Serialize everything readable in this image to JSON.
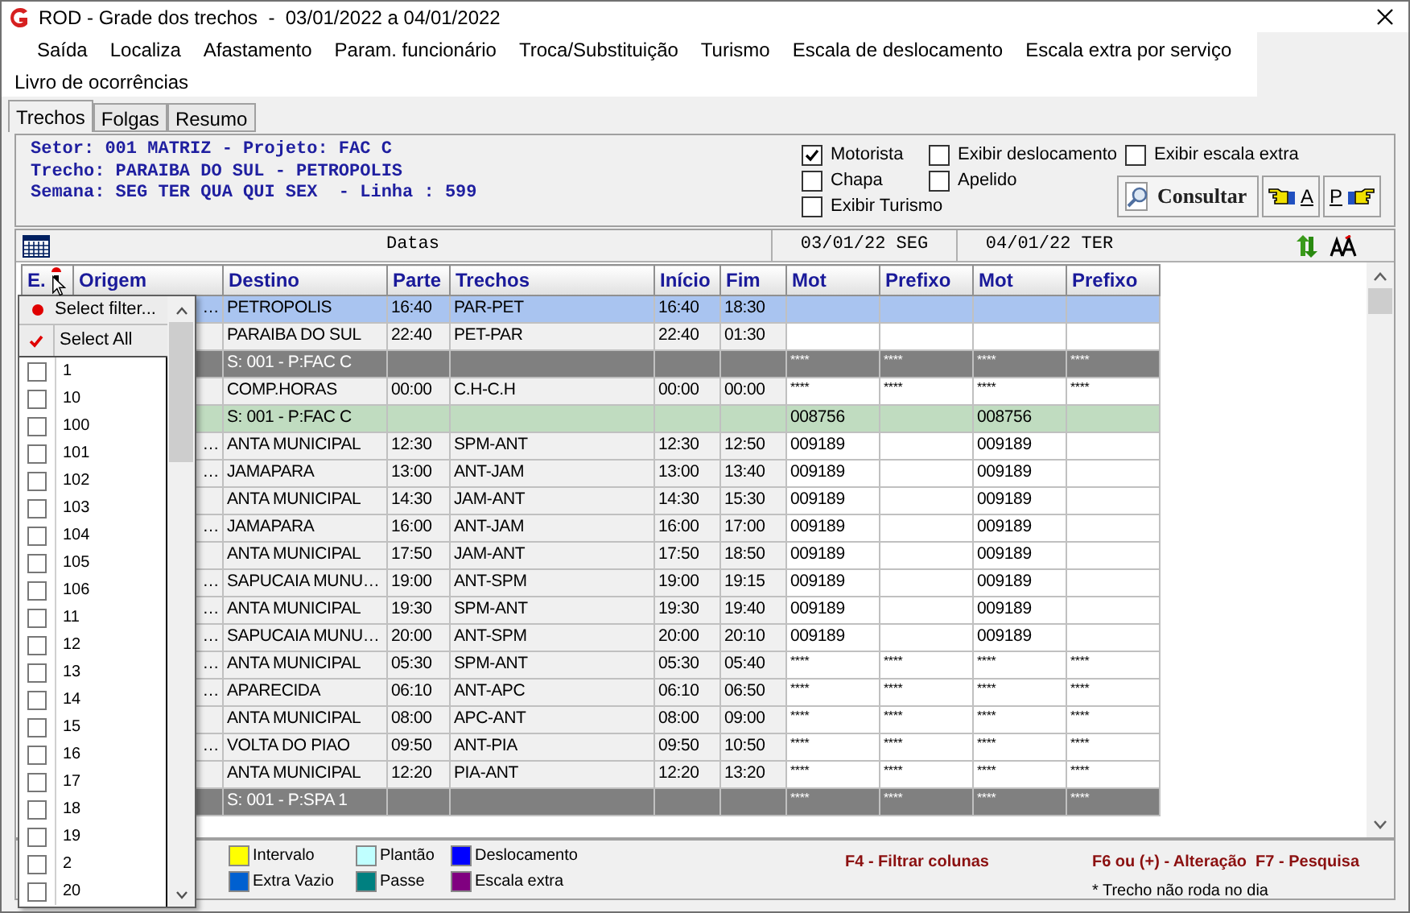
{
  "window": {
    "title": "ROD - Grade dos trechos  -  03/01/2022 a 04/01/2022"
  },
  "menu": [
    "Saída",
    "Localiza",
    "Afastamento",
    "Param. funcionário",
    "Troca/Substituição",
    "Turismo",
    "Escala de deslocamento",
    "Escala extra por serviço",
    "Livro de ocorrências"
  ],
  "tabs": [
    {
      "label": "Trechos",
      "selected": true
    },
    {
      "label": "Folgas",
      "selected": false
    },
    {
      "label": "Resumo",
      "selected": false
    }
  ],
  "info": [
    "Setor: 001 MATRIZ - Projeto: FAC C",
    "Trecho: PARAIBA DO SUL - PETROPOLIS",
    "Semana: SEG TER QUA QUI SEX  - Linha : 599"
  ],
  "options": [
    {
      "label": "Motorista",
      "checked": true
    },
    {
      "label": "Exibir deslocamento",
      "checked": false
    },
    {
      "label": "Exibir escala extra",
      "checked": false
    },
    {
      "label": "Chapa",
      "checked": false
    },
    {
      "label": "Apelido",
      "checked": false
    },
    {
      "label": "Exibir Turismo",
      "checked": false
    }
  ],
  "buttons": {
    "consultar": "Consultar",
    "previous": "A",
    "next": "P"
  },
  "grid_header": {
    "title": "Datas",
    "dates": [
      "03/01/22 SEG",
      "04/01/22 TER"
    ]
  },
  "columns": [
    "E.",
    "Origem",
    "Destino",
    "Parte",
    "Trechos",
    "Início",
    "Fim",
    "Mot",
    "Prefixo",
    "Mot",
    "Prefixo"
  ],
  "rows": [
    {
      "kind": "normal",
      "selected": true,
      "origem": "…",
      "destino": "PETROPOLIS",
      "parte": "16:40",
      "trechos": "PAR-PET",
      "inicio": "16:40",
      "fim": "18:30",
      "cells": [
        null,
        null,
        null,
        null
      ]
    },
    {
      "kind": "normal",
      "selected": false,
      "destino": "PARAIBA DO SUL",
      "parte": "22:40",
      "trechos": "PET-PAR",
      "inicio": "22:40",
      "fim": "01:30",
      "cells": [
        null,
        null,
        null,
        null
      ]
    },
    {
      "kind": "group",
      "selected": false,
      "destino": "S: 001 - P:FAC C",
      "cells": [
        "****",
        "****",
        "****",
        "****"
      ]
    },
    {
      "kind": "normal",
      "selected": false,
      "destino": "COMP.HORAS",
      "parte": "00:00",
      "trechos": "C.H-C.H",
      "inicio": "00:00",
      "fim": "00:00",
      "cells": [
        "****",
        "****",
        "****",
        "****"
      ]
    },
    {
      "kind": "highlight",
      "selected": false,
      "destino": "S: 001 - P:FAC C",
      "cells": [
        "008756",
        null,
        "008756",
        null
      ]
    },
    {
      "kind": "normal",
      "selected": false,
      "origem": "…",
      "destino": "ANTA MUNICIPAL",
      "parte": "12:30",
      "trechos": "SPM-ANT",
      "inicio": "12:30",
      "fim": "12:50",
      "cells": [
        "009189",
        null,
        "009189",
        null
      ]
    },
    {
      "kind": "normal",
      "selected": false,
      "origem": "…",
      "destino": "JAMAPARA",
      "parte": "13:00",
      "trechos": "ANT-JAM",
      "inicio": "13:00",
      "fim": "13:40",
      "cells": [
        "009189",
        null,
        "009189",
        null
      ]
    },
    {
      "kind": "normal",
      "selected": false,
      "destino": "ANTA MUNICIPAL",
      "parte": "14:30",
      "trechos": "JAM-ANT",
      "inicio": "14:30",
      "fim": "15:30",
      "cells": [
        "009189",
        null,
        "009189",
        null
      ]
    },
    {
      "kind": "normal",
      "selected": false,
      "origem": "…",
      "destino": "JAMAPARA",
      "parte": "16:00",
      "trechos": "ANT-JAM",
      "inicio": "16:00",
      "fim": "17:00",
      "cells": [
        "009189",
        null,
        "009189",
        null
      ]
    },
    {
      "kind": "normal",
      "selected": false,
      "destino": "ANTA MUNICIPAL",
      "parte": "17:50",
      "trechos": "JAM-ANT",
      "inicio": "17:50",
      "fim": "18:50",
      "cells": [
        "009189",
        null,
        "009189",
        null
      ]
    },
    {
      "kind": "normal",
      "selected": false,
      "origem": "…",
      "destino": "SAPUCAIA MUNU…",
      "parte": "19:00",
      "trechos": "ANT-SPM",
      "inicio": "19:00",
      "fim": "19:15",
      "cells": [
        "009189",
        null,
        "009189",
        null
      ]
    },
    {
      "kind": "normal",
      "selected": false,
      "origem": "…",
      "destino": "ANTA MUNICIPAL",
      "parte": "19:30",
      "trechos": "SPM-ANT",
      "inicio": "19:30",
      "fim": "19:40",
      "cells": [
        "009189",
        null,
        "009189",
        null
      ]
    },
    {
      "kind": "normal",
      "selected": false,
      "origem": "…",
      "destino": "SAPUCAIA MUNU…",
      "parte": "20:00",
      "trechos": "ANT-SPM",
      "inicio": "20:00",
      "fim": "20:10",
      "cells": [
        "009189",
        null,
        "009189",
        null
      ]
    },
    {
      "kind": "normal",
      "selected": false,
      "origem": "…",
      "destino": "ANTA MUNICIPAL",
      "parte": "05:30",
      "trechos": "SPM-ANT",
      "inicio": "05:30",
      "fim": "05:40",
      "cells": [
        "****",
        "****",
        "****",
        "****"
      ]
    },
    {
      "kind": "normal",
      "selected": false,
      "origem": "…",
      "destino": "APARECIDA",
      "parte": "06:10",
      "trechos": "ANT-APC",
      "inicio": "06:10",
      "fim": "06:50",
      "cells": [
        "****",
        "****",
        "****",
        "****"
      ]
    },
    {
      "kind": "normal",
      "selected": false,
      "destino": "ANTA MUNICIPAL",
      "parte": "08:00",
      "trechos": "APC-ANT",
      "inicio": "08:00",
      "fim": "09:00",
      "cells": [
        "****",
        "****",
        "****",
        "****"
      ]
    },
    {
      "kind": "normal",
      "selected": false,
      "origem": "…",
      "destino": "VOLTA DO PIAO",
      "parte": "09:50",
      "trechos": "ANT-PIA",
      "inicio": "09:50",
      "fim": "10:50",
      "cells": [
        "****",
        "****",
        "****",
        "****"
      ]
    },
    {
      "kind": "normal",
      "selected": false,
      "destino": "ANTA MUNICIPAL",
      "parte": "12:20",
      "trechos": "PIA-ANT",
      "inicio": "12:20",
      "fim": "13:20",
      "cells": [
        "****",
        "****",
        "****",
        "****"
      ]
    },
    {
      "kind": "group",
      "selected": false,
      "destino": "S: 001 - P:SPA 1",
      "cells": [
        "****",
        "****",
        "****",
        "****"
      ]
    }
  ],
  "filter_dropdown": {
    "select_filter": "Select filter...",
    "select_all": "Select All",
    "items": [
      {
        "label": "1",
        "checked": false
      },
      {
        "label": "10",
        "checked": false
      },
      {
        "label": "100",
        "checked": false
      },
      {
        "label": "101",
        "checked": false
      },
      {
        "label": "102",
        "checked": false
      },
      {
        "label": "103",
        "checked": false
      },
      {
        "label": "104",
        "checked": false
      },
      {
        "label": "105",
        "checked": false
      },
      {
        "label": "106",
        "checked": false
      },
      {
        "label": "11",
        "checked": false
      },
      {
        "label": "12",
        "checked": false
      },
      {
        "label": "13",
        "checked": false
      },
      {
        "label": "14",
        "checked": false
      },
      {
        "label": "15",
        "checked": false
      },
      {
        "label": "16",
        "checked": false
      },
      {
        "label": "17",
        "checked": false
      },
      {
        "label": "18",
        "checked": false
      },
      {
        "label": "19",
        "checked": false
      },
      {
        "label": "2",
        "checked": false
      },
      {
        "label": "20",
        "checked": false
      }
    ]
  },
  "legend": [
    {
      "label": "Intervalo",
      "color": "#ffff00"
    },
    {
      "label": "Plantão",
      "color": "#c0ffff"
    },
    {
      "label": "Deslocamento",
      "color": "#0000ff"
    },
    {
      "label": "Extra Vazio",
      "color": "#0060d0"
    },
    {
      "label": "Passe",
      "color": "#008080"
    },
    {
      "label": "Escala extra",
      "color": "#800080"
    }
  ],
  "hints": {
    "filter": "F4 - Filtrar colunas",
    "keys": "F6 ou (+) - Alteração  F7 - Pesquisa",
    "note": "* Trecho não roda no dia"
  }
}
